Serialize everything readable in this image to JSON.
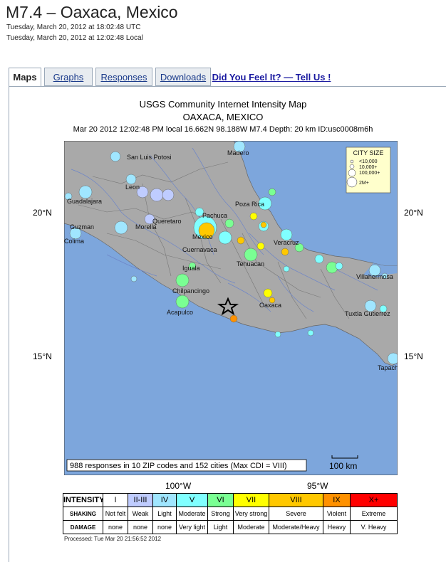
{
  "header": {
    "title": "M7.4 – Oaxaca, Mexico",
    "utc_time": "Tuesday, March 20, 2012 at 18:02:48 UTC",
    "local_time": "Tuesday, March 20, 2012 at 12:02:48 Local"
  },
  "tabs": {
    "maps": "Maps",
    "graphs": "Graphs",
    "responses": "Responses",
    "downloads": "Downloads",
    "dyfi": "Did You Feel It? — Tell Us !"
  },
  "map": {
    "title": "USGS Community Internet Intensity Map",
    "region": "OAXACA, MEXICO",
    "event_info": "Mar 20 2012 12:02:48 PM local 16.662N 98.188W M7.4 Depth: 20 km ID:usc0008m6h",
    "lat_labels": [
      "20°N",
      "15°N"
    ],
    "lon_labels": [
      "100°W",
      "95°W"
    ],
    "responses_note": "988 responses in 10 ZIP codes and 152 cities (Max CDI = VIII)",
    "scale_label": "100 km",
    "city_size_legend": {
      "title": "CITY SIZE",
      "entries": [
        "<10,000",
        "10,000+",
        "100,000+",
        "2M+"
      ]
    },
    "cities": [
      {
        "name": "Madero"
      },
      {
        "name": "San Luis Potosi"
      },
      {
        "name": "Leon"
      },
      {
        "name": "Guadalajara"
      },
      {
        "name": "Queretaro"
      },
      {
        "name": "Pachuca"
      },
      {
        "name": "Poza Rica"
      },
      {
        "name": "Guzman"
      },
      {
        "name": "Morelia"
      },
      {
        "name": "Mexico"
      },
      {
        "name": "Colima"
      },
      {
        "name": "Cuernavaca"
      },
      {
        "name": "Veracruz"
      },
      {
        "name": "Iguala"
      },
      {
        "name": "Tehuacan"
      },
      {
        "name": "Villahermosa"
      },
      {
        "name": "Chilpancingo"
      },
      {
        "name": "Oaxaca"
      },
      {
        "name": "Acapulco"
      },
      {
        "name": "Tuxtla Gutierrez"
      },
      {
        "name": "Tapachula"
      }
    ],
    "colors": {
      "ocean": "#7da6dc",
      "land": "#a9a9a9",
      "river": "#6e86c8",
      "epicenter": "#000000"
    }
  },
  "legend": {
    "row_labels": [
      "INTENSITY",
      "SHAKING",
      "DAMAGE"
    ],
    "levels": [
      {
        "intensity": "I",
        "shaking": "Not felt",
        "damage": "none",
        "color": "#ffffff"
      },
      {
        "intensity": "II-III",
        "shaking": "Weak",
        "damage": "none",
        "color": "#bfccff"
      },
      {
        "intensity": "IV",
        "shaking": "Light",
        "damage": "none",
        "color": "#a0e6ff"
      },
      {
        "intensity": "V",
        "shaking": "Moderate",
        "damage": "Very light",
        "color": "#80ffff"
      },
      {
        "intensity": "VI",
        "shaking": "Strong",
        "damage": "Light",
        "color": "#7aff93"
      },
      {
        "intensity": "VII",
        "shaking": "Very strong",
        "damage": "Moderate",
        "color": "#ffff00"
      },
      {
        "intensity": "VIII",
        "shaking": "Severe",
        "damage": "Moderate/Heavy",
        "color": "#ffc800"
      },
      {
        "intensity": "IX",
        "shaking": "Violent",
        "damage": "Heavy",
        "color": "#ff9100"
      },
      {
        "intensity": "X+",
        "shaking": "Extreme",
        "damage": "V. Heavy",
        "color": "#ff0000"
      }
    ]
  },
  "footer": {
    "processed": "Processed: Tue Mar 20 21:56:52 2012"
  }
}
